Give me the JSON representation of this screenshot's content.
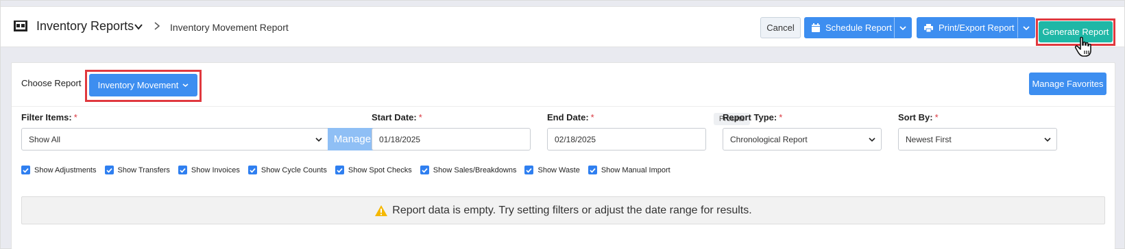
{
  "header": {
    "title": "Inventory Reports",
    "breadcrumb": "Inventory Movement Report",
    "cancel_label": "Cancel",
    "schedule_label": "Schedule Report",
    "print_label": "Print/Export Report",
    "generate_label": "Generate Report"
  },
  "toolbar": {
    "choose_label": "Choose Report",
    "report_selected": "Inventory Movement",
    "favorites_label": "Manage Favorites"
  },
  "filters": {
    "filter_items": {
      "label": "Filter Items:",
      "required": "*",
      "value": "Show All",
      "manage_label": "Manage"
    },
    "start_date": {
      "label": "Start Date:",
      "required": "*",
      "value": "01/18/2025"
    },
    "end_date": {
      "label": "End Date:",
      "required": "*",
      "value": "02/18/2025",
      "presets_label": "Presets"
    },
    "report_type": {
      "label": "Report Type:",
      "required": "*",
      "value": "Chronological Report"
    },
    "sort_by": {
      "label": "Sort By:",
      "required": "*",
      "value": "Newest First"
    }
  },
  "checkboxes": [
    {
      "label": "Show Adjustments",
      "checked": true
    },
    {
      "label": "Show Transfers",
      "checked": true
    },
    {
      "label": "Show Invoices",
      "checked": true
    },
    {
      "label": "Show Cycle Counts",
      "checked": true
    },
    {
      "label": "Show Spot Checks",
      "checked": true
    },
    {
      "label": "Show Sales/Breakdowns",
      "checked": true
    },
    {
      "label": "Show Waste",
      "checked": true
    },
    {
      "label": "Show Manual Import",
      "checked": true
    }
  ],
  "alert": {
    "message": "Report data is empty. Try setting filters or adjust the date range for results."
  },
  "colors": {
    "primary": "#3d8ef0",
    "generate": "#1fb7a6",
    "highlight": "#e0383e",
    "warning": "#f5b800",
    "required": "#d9363e"
  }
}
